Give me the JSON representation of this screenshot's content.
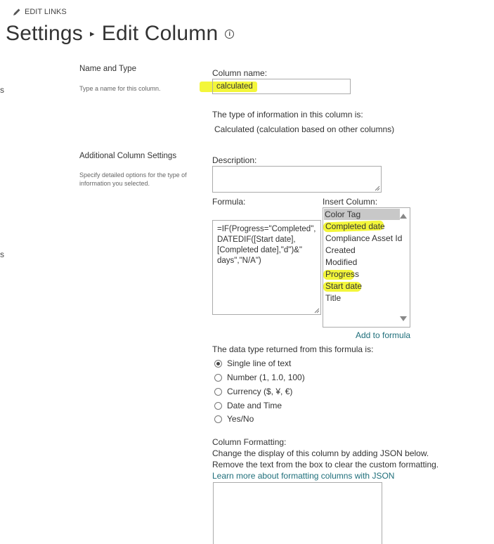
{
  "header": {
    "edit_links": "EDIT LINKS",
    "breadcrumb_parent": "Settings",
    "separator": "▸",
    "page_title": "Edit Column",
    "info": "i"
  },
  "left_cut": {
    "top": "s",
    "bottom": "s"
  },
  "name_type": {
    "title": "Name and Type",
    "description": "Type a name for this column.",
    "column_name_label": "Column name:",
    "column_name_value": "calculated",
    "type_intro": "The type of information in this column is:",
    "type_value": "Calculated (calculation based on other columns)"
  },
  "additional": {
    "title": "Additional Column Settings",
    "description_line1": "Specify detailed options for the type of",
    "description_line2": "information you selected.",
    "description_label": "Description:",
    "description_value": "",
    "formula_label": "Formula:",
    "formula_value": "=IF(Progress=\"Completed\",\nDATEDIF([Start date],\n[Completed date],\"d\")&\"\ndays\",\"N/A\")",
    "insert_column_label": "Insert Column:",
    "insert_columns": [
      "Color Tag",
      "Completed date",
      "Compliance Asset Id",
      "Created",
      "Modified",
      "Progress",
      "Start date",
      "Title"
    ],
    "add_to_formula": "Add to formula"
  },
  "return_type": {
    "label": "The data type returned from this formula is:",
    "options": [
      "Single line of text",
      "Number (1, 1.0, 100)",
      "Currency ($, ¥, €)",
      "Date and Time",
      "Yes/No"
    ],
    "selected": "Single line of text"
  },
  "formatting": {
    "label": "Column Formatting:",
    "line1": "Change the display of this column by adding JSON below.",
    "line2": "Remove the text from the box to clear the custom formatting.",
    "learn_more": "Learn more about formatting columns with JSON",
    "json_value": ""
  },
  "colors": {
    "highlight": "#f3f63a",
    "link": "#1e6e7a",
    "selected_option": "#c8c8c8"
  }
}
